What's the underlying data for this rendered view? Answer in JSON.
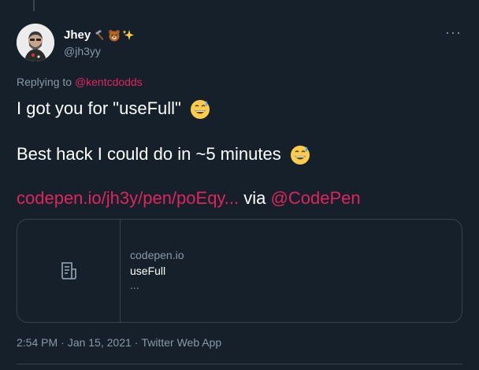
{
  "tweet": {
    "author_name": "Jhey",
    "author_emojis": [
      "hammer-pick-emoji",
      "bear-emoji",
      "sparkles-emoji"
    ],
    "handle": "@jh3yy",
    "more_label": "···",
    "replying_prefix": "Replying to",
    "replying_handle": "@kentcdodds",
    "line1": "I got you for \"useFull\"",
    "line2": "Best hack I could do in ~5 minutes",
    "link_text": "codepen.io/jh3y/pen/poEqy...",
    "via_text": "via",
    "via_handle": "@CodePen",
    "card": {
      "domain": "codepen.io",
      "title": "useFull",
      "description": "..."
    },
    "time": "2:54 PM",
    "date": "Jan 15, 2021",
    "source": "Twitter Web App",
    "separator": "·"
  },
  "colors": {
    "background": "#15202b",
    "accent": "#e0245e",
    "muted": "#8899a6",
    "border": "#38444d"
  }
}
